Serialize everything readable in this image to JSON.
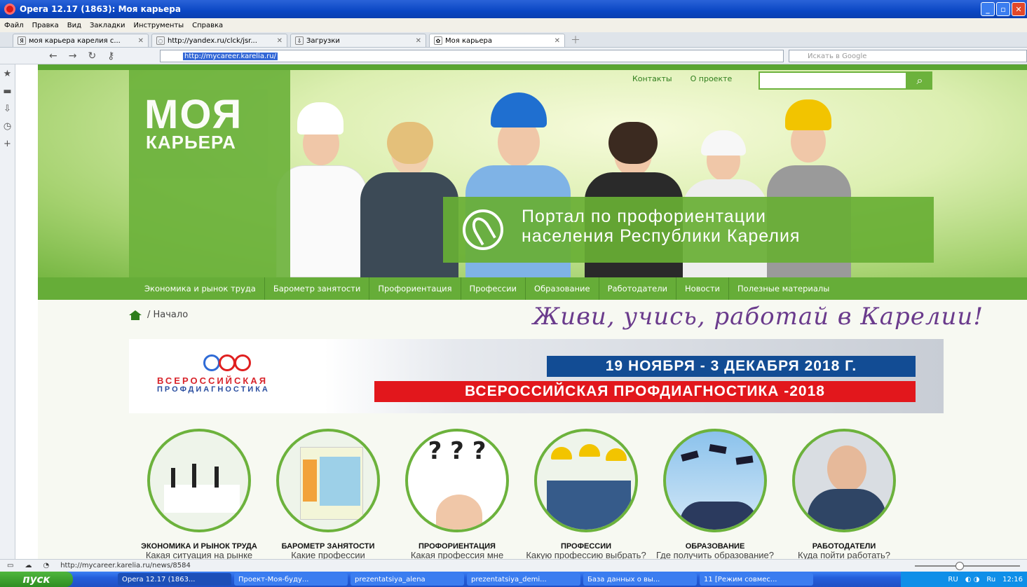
{
  "window": {
    "title": "Opera 12.17 (1863): Моя карьера"
  },
  "menu": [
    "Файл",
    "Правка",
    "Вид",
    "Закладки",
    "Инструменты",
    "Справка"
  ],
  "tabs": [
    {
      "label": "моя карьера карелия с...",
      "icon": "yandex-icon",
      "active": false
    },
    {
      "label": "http://yandex.ru/clck/jsr...",
      "icon": "loading-icon",
      "active": false
    },
    {
      "label": "Загрузки",
      "icon": "downloads-icon",
      "active": false
    },
    {
      "label": "Моя карьера",
      "icon": "site-icon",
      "active": true
    }
  ],
  "address": {
    "url": "http://mycareer.karelia.ru/",
    "search_placeholder": "Искать в Google"
  },
  "site": {
    "logo_line1": "МОЯ",
    "logo_line2": "КАРЬЕРА",
    "top_links": [
      "Контакты",
      "О проекте"
    ],
    "portal_line1": "Портал по профориентации",
    "portal_line2": "населения Республики Карелия",
    "nav": [
      "Экономика и рынок труда",
      "Барометр занятости",
      "Профориентация",
      "Профессии",
      "Образование",
      "Работодатели",
      "Новости",
      "Полезные материалы"
    ],
    "breadcrumb": "/ Начало",
    "slogan": "Живи, учись, работай в Карелии!",
    "banner": {
      "brand_line1": "ВСЕРОССИЙСКАЯ",
      "brand_line2": "ПРОФДИАГНОСТИКА",
      "dates": "19 НОЯБРЯ - 3 ДЕКАБРЯ 2018 Г.",
      "title": "ВСЕРОССИЙСКАЯ ПРОФДИАГНОСТИКА -2018"
    },
    "categories": [
      {
        "title": "ЭКОНОМИКА И РЫНОК ТРУДА",
        "subtitle": "Какая ситуация на рынке труда?"
      },
      {
        "title": "БАРОМЕТР ЗАНЯТОСТИ",
        "subtitle": "Какие профессии востребованы?"
      },
      {
        "title": "ПРОФОРИЕНТАЦИЯ",
        "subtitle": "Какая профессия мне подходит?"
      },
      {
        "title": "ПРОФЕССИИ",
        "subtitle": "Какую профессию выбрать?"
      },
      {
        "title": "ОБРАЗОВАНИЕ",
        "subtitle": "Где получить образование?"
      },
      {
        "title": "РАБОТОДАТЕЛИ",
        "subtitle": "Куда пойти работать?"
      }
    ]
  },
  "status": {
    "url": "http://mycareer.karelia.ru/news/8584"
  },
  "taskbar": {
    "start": "пуск",
    "items": [
      "Opera 12.17 (1863...",
      "Проект-Моя-буду...",
      "prezentatsiya_alena",
      "prezentatsiya_demi...",
      "База данных о вы...",
      "11 [Режим совмес..."
    ],
    "lang": "RU",
    "lang2": "Ru",
    "time": "12:16"
  },
  "colors": {
    "green": "#6cb23c",
    "nav_green": "#66ad38",
    "slogan_purple": "#6a3b8c",
    "banner_blue": "#124c94",
    "banner_red": "#e2171c"
  }
}
